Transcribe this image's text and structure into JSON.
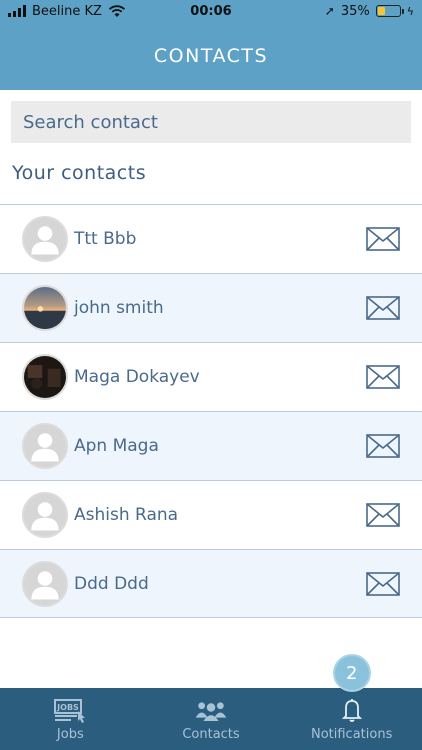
{
  "status": {
    "carrier": "Beeline KZ",
    "time": "00:06",
    "battery": "35%",
    "battery_level": 0.35
  },
  "header": {
    "title": "CONTACTS"
  },
  "search": {
    "placeholder": "Search contact"
  },
  "section": {
    "title": "Your contacts"
  },
  "contacts": [
    {
      "name": "Ttt Bbb",
      "avatar": "default-avatar-icon"
    },
    {
      "name": "john smith",
      "avatar": "sunset-photo"
    },
    {
      "name": "Maga Dokayev",
      "avatar": "dark-room-photo"
    },
    {
      "name": "Apn Maga",
      "avatar": "default-avatar-icon"
    },
    {
      "name": "Ashish Rana",
      "avatar": "default-avatar-icon"
    },
    {
      "name": "Ddd Ddd",
      "avatar": "default-avatar-icon"
    }
  ],
  "tabs": [
    {
      "label": "Jobs",
      "icon": "jobs-icon"
    },
    {
      "label": "Contacts",
      "icon": "contacts-group-icon"
    },
    {
      "label": "Notifications",
      "icon": "bell-icon",
      "badge": "2"
    }
  ],
  "colors": {
    "header": "#5da1c7",
    "tabbar": "#2a5d7e",
    "text": "#4a6a8c",
    "row_alt": "#eef5fd",
    "badge": "#8ac2db"
  }
}
